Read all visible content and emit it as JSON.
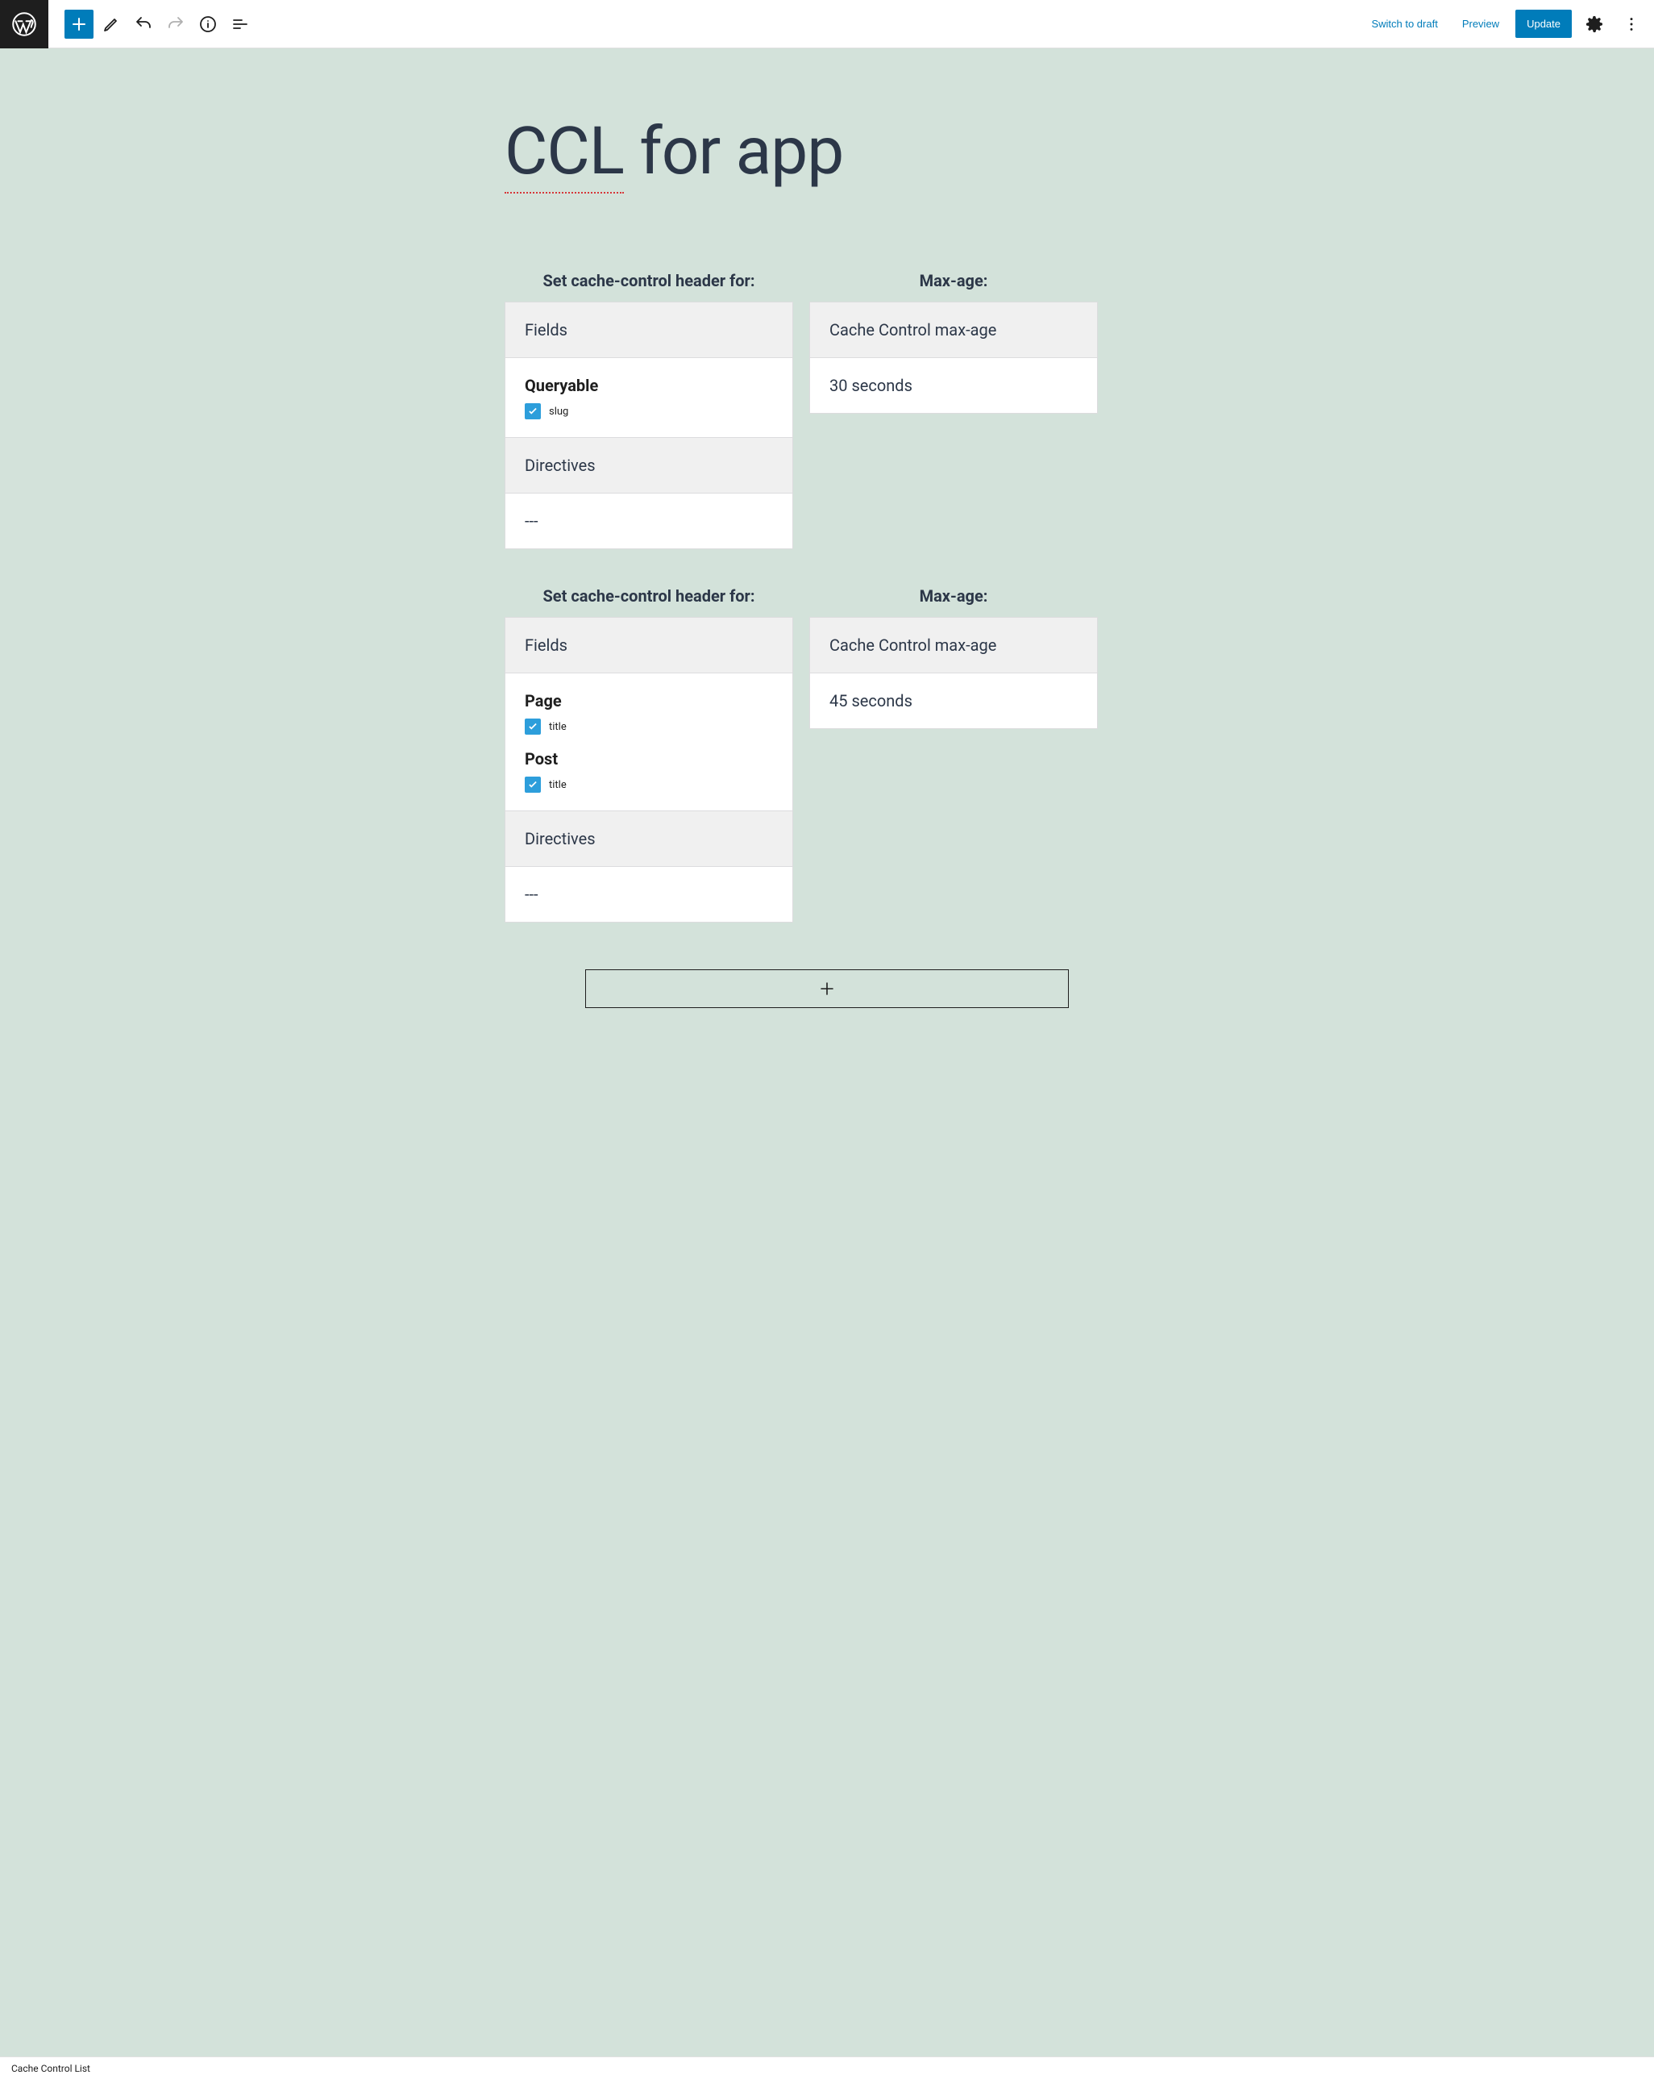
{
  "toolbar": {
    "switch_to_draft": "Switch to draft",
    "preview": "Preview",
    "update": "Update"
  },
  "page_title_parts": {
    "misspelled": "CCL",
    "rest": " for app"
  },
  "blocks": [
    {
      "left_heading": "Set cache-control header for:",
      "right_heading": "Max-age:",
      "fields_label": "Fields",
      "types": [
        {
          "name": "Queryable",
          "fields": [
            {
              "label": "slug",
              "checked": true
            }
          ]
        }
      ],
      "directives_label": "Directives",
      "directives_value": "---",
      "maxage_label": "Cache Control max-age",
      "maxage_value": "30 seconds"
    },
    {
      "left_heading": "Set cache-control header for:",
      "right_heading": "Max-age:",
      "fields_label": "Fields",
      "types": [
        {
          "name": "Page",
          "fields": [
            {
              "label": "title",
              "checked": true
            }
          ]
        },
        {
          "name": "Post",
          "fields": [
            {
              "label": "title",
              "checked": true
            }
          ]
        }
      ],
      "directives_label": "Directives",
      "directives_value": "---",
      "maxage_label": "Cache Control max-age",
      "maxage_value": "45 seconds"
    }
  ],
  "footer_breadcrumb": "Cache Control List"
}
